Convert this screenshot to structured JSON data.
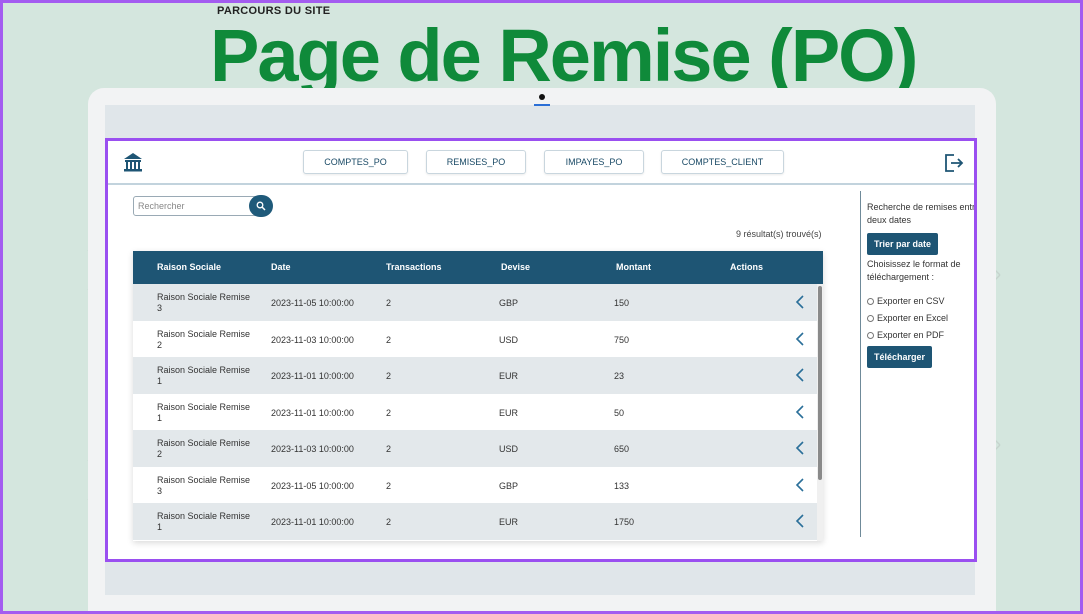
{
  "slide": {
    "label": "PARCOURS DU SITE",
    "title": "Page de Remise (PO)"
  },
  "colors": {
    "title_green": "#0f8a3a",
    "header_blue": "#1e5574",
    "frame_purple": "#9a4ff0",
    "background": "#d4e6de"
  },
  "nav": {
    "items": [
      "COMPTES_PO",
      "REMISES_PO",
      "IMPAYES_PO",
      "COMPTES_CLIENT"
    ],
    "logo_icon": "bank-icon",
    "logout_icon": "logout-icon"
  },
  "search": {
    "placeholder": "Rechercher",
    "icon": "search-icon"
  },
  "results": {
    "count_text": "9 résultat(s) trouvé(s)"
  },
  "table": {
    "headers": [
      "Raison Sociale",
      "Date",
      "Transactions",
      "Devise",
      "Montant",
      "Actions"
    ],
    "rows": [
      {
        "raison_l1": "Raison Sociale Remise",
        "raison_l2": "3",
        "date": "2023-11-05 10:00:00",
        "transactions": "2",
        "devise": "GBP",
        "montant": "150"
      },
      {
        "raison_l1": "Raison Sociale Remise",
        "raison_l2": "2",
        "date": "2023-11-03 10:00:00",
        "transactions": "2",
        "devise": "USD",
        "montant": "750"
      },
      {
        "raison_l1": "Raison Sociale Remise",
        "raison_l2": "1",
        "date": "2023-11-01 10:00:00",
        "transactions": "2",
        "devise": "EUR",
        "montant": "23"
      },
      {
        "raison_l1": "Raison Sociale Remise",
        "raison_l2": "1",
        "date": "2023-11-01 10:00:00",
        "transactions": "2",
        "devise": "EUR",
        "montant": "50"
      },
      {
        "raison_l1": "Raison Sociale Remise",
        "raison_l2": "2",
        "date": "2023-11-03 10:00:00",
        "transactions": "2",
        "devise": "USD",
        "montant": "650"
      },
      {
        "raison_l1": "Raison Sociale Remise",
        "raison_l2": "3",
        "date": "2023-11-05 10:00:00",
        "transactions": "2",
        "devise": "GBP",
        "montant": "133"
      },
      {
        "raison_l1": "Raison Sociale Remise",
        "raison_l2": "1",
        "date": "2023-11-01 10:00:00",
        "transactions": "2",
        "devise": "EUR",
        "montant": "1750"
      }
    ],
    "action_icon": "chevron-left-icon"
  },
  "sidebar": {
    "search_text_l1": "Recherche de remises entr",
    "search_text_l2": "deux dates",
    "sort_button": "Trier par date",
    "format_text_l1": "Choisissez le format de",
    "format_text_l2": "téléchargement :",
    "options": [
      "Exporter en CSV",
      "Exporter en Excel",
      "Exporter en PDF"
    ],
    "download_button": "Télécharger"
  }
}
